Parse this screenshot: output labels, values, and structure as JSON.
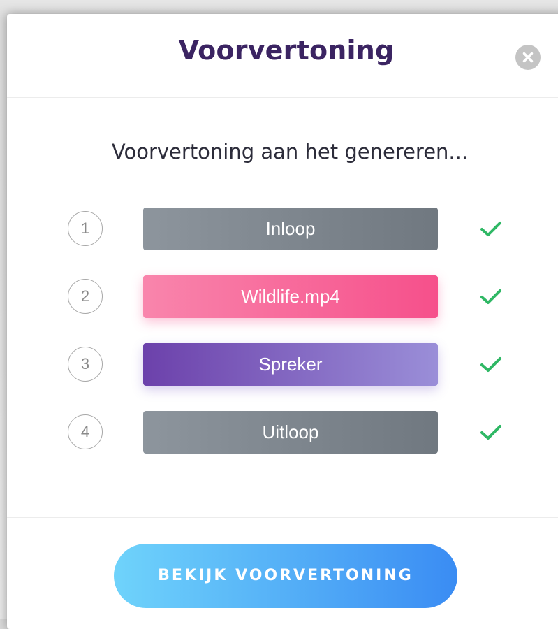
{
  "dialog": {
    "title": "Voorvertoning",
    "close_icon": "close-icon"
  },
  "status": {
    "text": "Voorvertoning aan het genereren..."
  },
  "steps": [
    {
      "number": "1",
      "label": "Inloop",
      "color": "#7c848c",
      "done_icon": "checkmark-icon"
    },
    {
      "number": "2",
      "label": "Wildlife.mp4",
      "color": "#f76a9b",
      "done_icon": "checkmark-icon"
    },
    {
      "number": "3",
      "label": "Spreker",
      "color": "#7f63c0",
      "done_icon": "checkmark-icon"
    },
    {
      "number": "4",
      "label": "Uitloop",
      "color": "#7c848c",
      "done_icon": "checkmark-icon"
    }
  ],
  "footer": {
    "button_label": "BEKIJK VOORVERTONING"
  },
  "colors": {
    "title": "#3b2462",
    "check": "#2fb865",
    "button_start": "#6fd3fb",
    "button_end": "#3a8cf3"
  }
}
